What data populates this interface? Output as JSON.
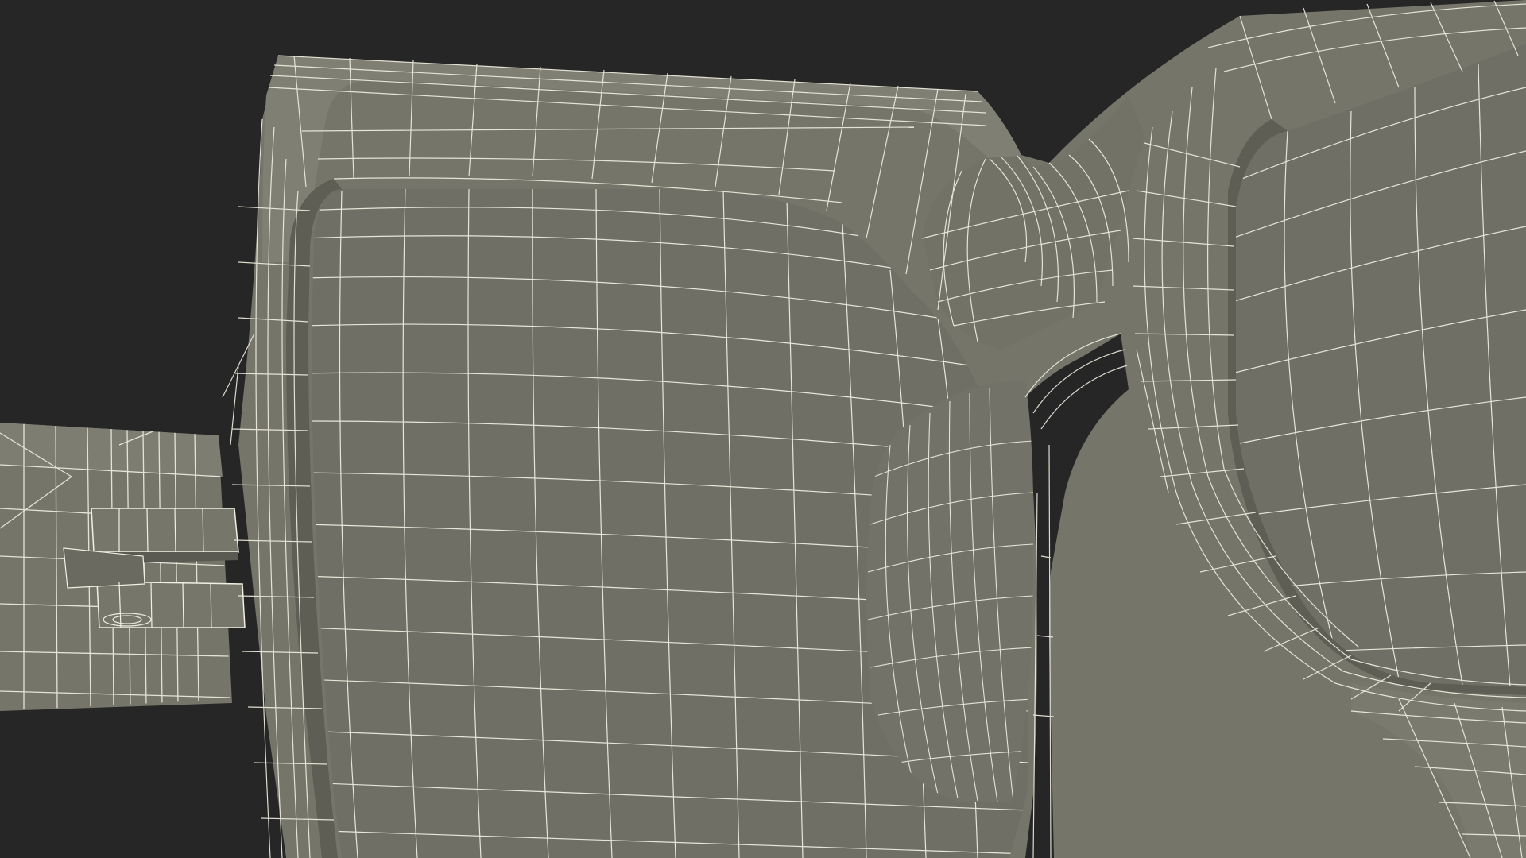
{
  "scene": {
    "subject": "wireframe-render",
    "colors": {
      "background": "#262626",
      "frame_fill": "#75756a",
      "frame_shadow": "#5f5f56",
      "frame_light": "#838377",
      "lens_fill": "#6e6e64",
      "wire": "#f1f0e2"
    }
  }
}
